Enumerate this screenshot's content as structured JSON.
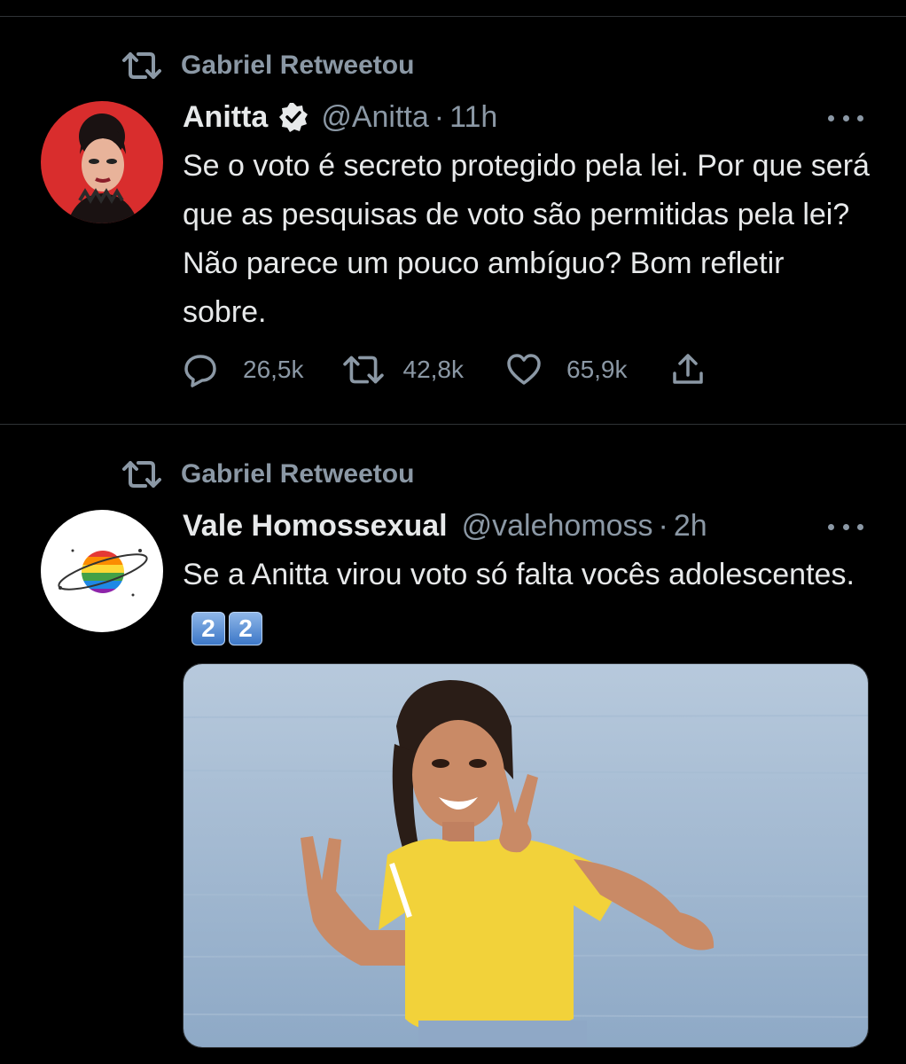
{
  "tweets": [
    {
      "retweet_by": "Gabriel Retweetou",
      "author_name": "Anitta",
      "verified": true,
      "handle": "@Anitta",
      "separator": "·",
      "time": "11h",
      "text": "Se o voto é secreto protegido pela lei. Por que será que as pesquisas de voto são permitidas pela lei? Não parece um pouco ambíguo? Bom refletir sobre.",
      "metrics": {
        "replies": "26,5k",
        "retweets": "42,8k",
        "likes": "65,9k"
      }
    },
    {
      "retweet_by": "Gabriel Retweetou",
      "author_name": "Vale Homossexual",
      "verified": false,
      "handle": "@valehomoss",
      "separator": "·",
      "time": "2h",
      "text": "Se a Anitta virou voto só falta vocês adolescentes.",
      "keycaps": [
        "2",
        "2"
      ]
    }
  ],
  "icons": {
    "retweet": "retweet-icon",
    "verified": "verified-badge-icon",
    "more": "more-icon",
    "reply": "reply-icon",
    "like": "heart-icon",
    "share": "share-icon"
  },
  "colors": {
    "background": "#000000",
    "text": "#e7e9ea",
    "secondary": "#8b98a5",
    "divider": "#2f3336"
  }
}
